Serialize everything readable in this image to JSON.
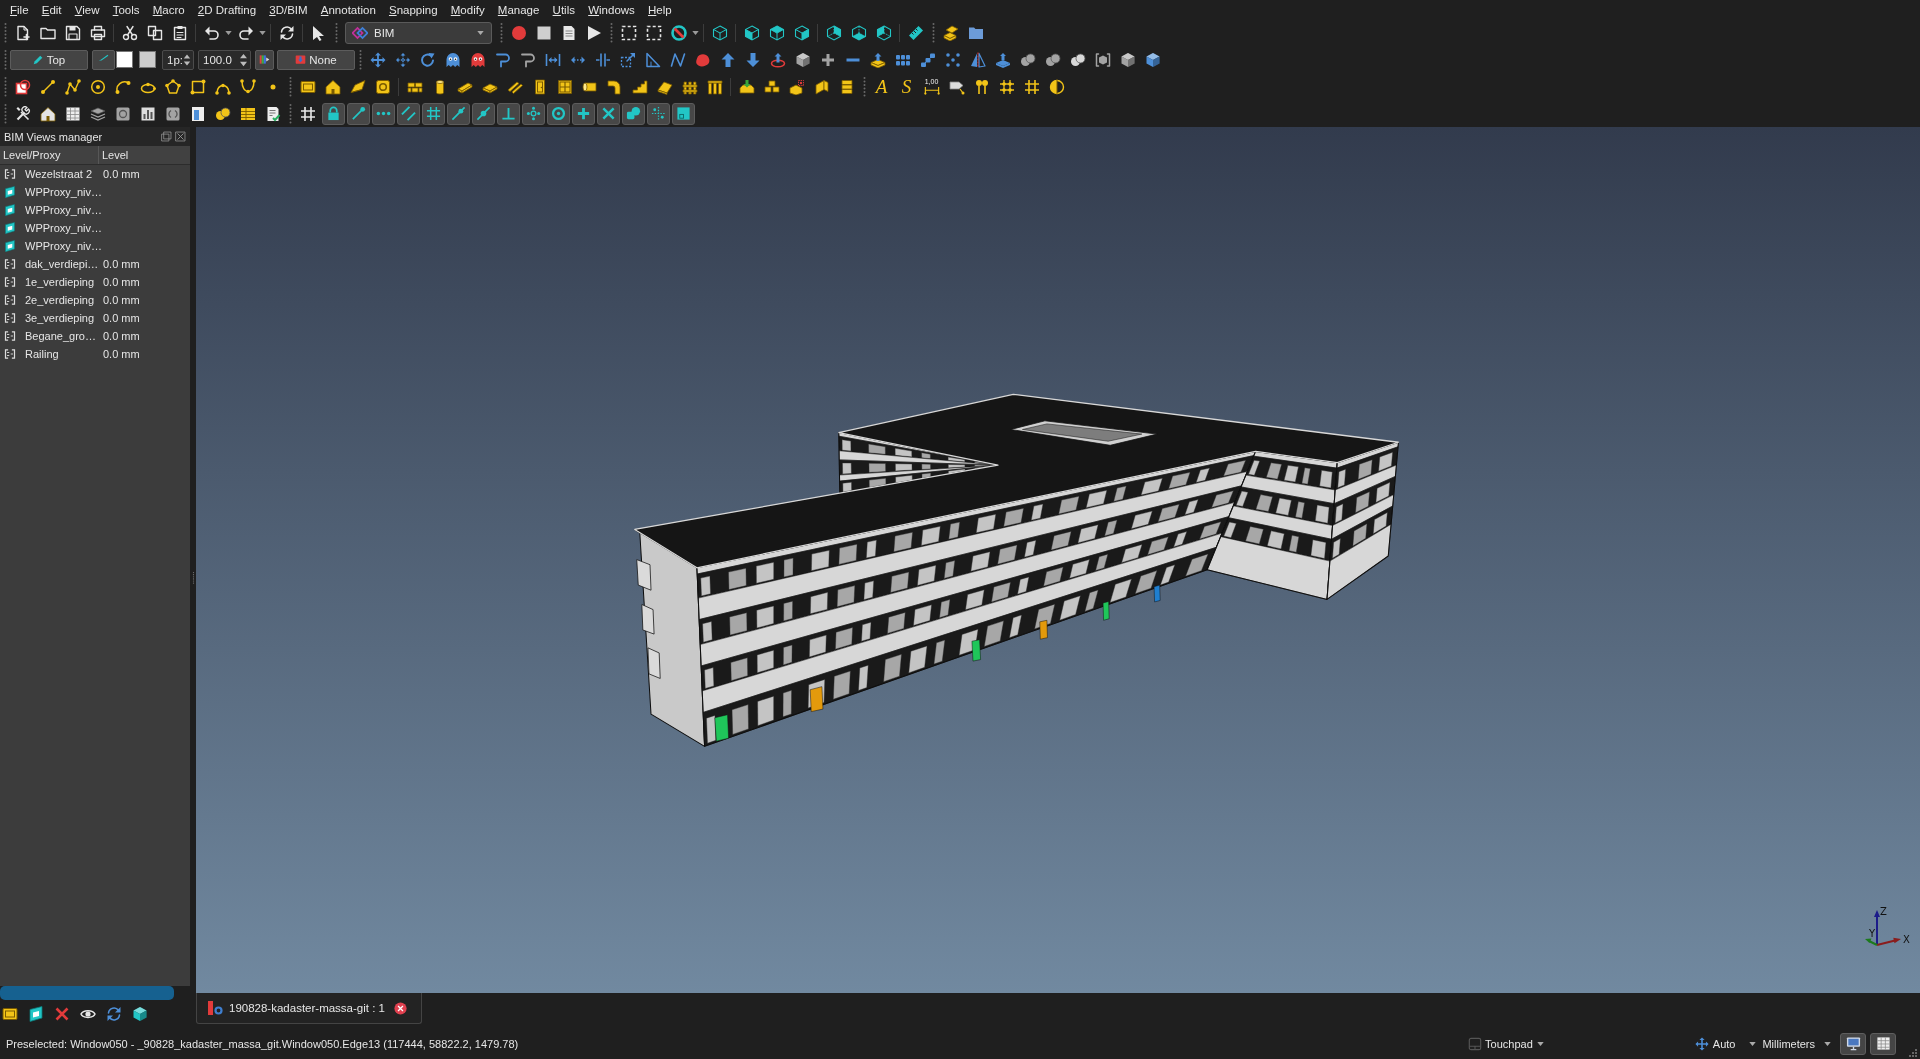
{
  "menu_bar": {
    "items": [
      "File",
      "Edit",
      "View",
      "Tools",
      "Macro",
      "2D Drafting",
      "3D/BIM",
      "Annotation",
      "Snapping",
      "Modify",
      "Manage",
      "Utils",
      "Windows",
      "Help"
    ]
  },
  "toolbars": {
    "workbench": "BIM",
    "working_plane": "Top",
    "swatches": [
      {
        "color": "#ffffff"
      },
      {
        "color": "#cccccc"
      }
    ],
    "line_width": "1p:",
    "number_field": "100.0",
    "group_button": "None",
    "text_tool": "A",
    "shape_string_tool": "S",
    "dimension_tool": "1,00",
    "snap_toggles": [
      {
        "on": true
      },
      {
        "on": true
      },
      {
        "on": true
      },
      {
        "on": true
      },
      {
        "on": true
      },
      {
        "on": true
      },
      {
        "on": true
      },
      {
        "on": true
      },
      {
        "on": true
      },
      {
        "on": true
      },
      {
        "on": true
      },
      {
        "on": true
      },
      {
        "on": true
      },
      {
        "on": true
      },
      {
        "on": true
      }
    ]
  },
  "views_manager": {
    "title": "BIM Views manager",
    "columns": [
      "Level/Proxy",
      "Level"
    ],
    "rows": [
      {
        "kind": "level",
        "name": "Wezelstraat 2",
        "elevation": "0.0 mm",
        "selected": false
      },
      {
        "kind": "proxy",
        "name": "WPProxy_niv…",
        "selected": false
      },
      {
        "kind": "proxy",
        "name": "WPProxy_niv…",
        "selected": false
      },
      {
        "kind": "proxy",
        "name": "WPProxy_niv…",
        "selected": false
      },
      {
        "kind": "proxy",
        "name": "WPProxy_niv…",
        "selected": false
      },
      {
        "kind": "level",
        "name": "dak_verdiepi…",
        "elevation": "0.0 mm",
        "selected": false
      },
      {
        "kind": "level",
        "name": "1e_verdieping",
        "elevation": "0.0 mm",
        "selected": false
      },
      {
        "kind": "level",
        "name": "2e_verdieping",
        "elevation": "0.0 mm",
        "selected": false
      },
      {
        "kind": "level",
        "name": "3e_verdieping",
        "elevation": "0.0 mm",
        "selected": false
      },
      {
        "kind": "level",
        "name": "Begane_gro…",
        "elevation": "0.0 mm",
        "selected": false
      },
      {
        "kind": "level",
        "name": "Railing",
        "elevation": "0.0 mm",
        "selected": false
      }
    ]
  },
  "document_tabs": [
    {
      "title": "190828-kadaster-massa-git : 1",
      "selected": true
    }
  ],
  "viewport": {
    "axes": {
      "x": "X",
      "y": "Y",
      "z": "Z"
    }
  },
  "status_bar": {
    "message": "Preselected: Window050 - _90828_kadaster_massa_git.Window050.Edge13 (117444, 58822.2, 1479.78)",
    "navigation": "Touchpad",
    "unit_mode": "Auto",
    "units": "Millimeters"
  }
}
